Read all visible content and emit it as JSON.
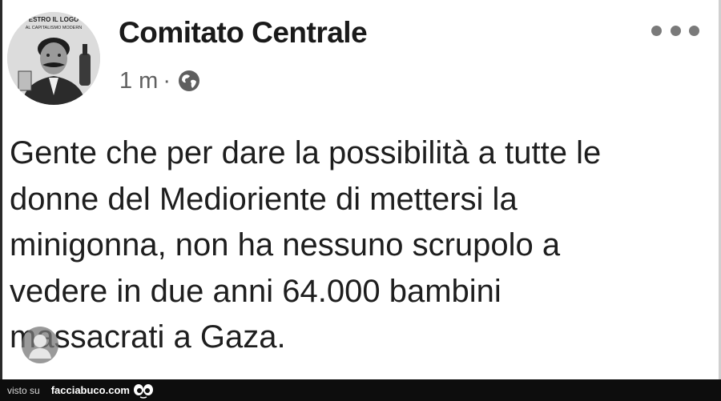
{
  "post": {
    "author": "Comitato Centrale",
    "timestamp": "1 m",
    "separator": "·",
    "privacy_icon": "globe-icon",
    "menu_icon": "more-options-icon",
    "avatar_text": "ESTRO IL LOGO / AL CAPITALISMO MODERN",
    "text": "Gente che per dare la possibilità a tutte le\ndonne del Medioriente di mettersi la\nminigonna, non ha nessuno scrupolo a\nvedere in due anni 64.000 bambini\nmassacrati a Gaza."
  },
  "footer": {
    "prefix": "visto su",
    "site": "facciabuco.com",
    "logo_icon": "eyes-icon"
  }
}
